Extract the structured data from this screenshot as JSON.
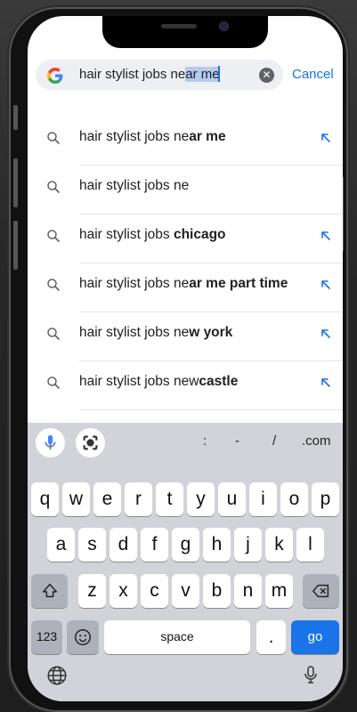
{
  "search": {
    "query_before": "hair stylist jobs ne",
    "query_selected": "ar me",
    "cancel_label": "Cancel",
    "clear_glyph": "✕"
  },
  "suggestions": [
    {
      "prefix": "hair stylist jobs ne",
      "bold": "ar me",
      "suffix": "",
      "has_arrow": true
    },
    {
      "prefix": "hair stylist jobs ne",
      "bold": "",
      "suffix": "",
      "has_arrow": false
    },
    {
      "prefix": "hair stylist jobs ",
      "bold": "chicago",
      "suffix": "",
      "has_arrow": true
    },
    {
      "prefix": "hair stylist jobs ne",
      "bold": "ar me part time",
      "suffix": "",
      "has_arrow": true
    },
    {
      "prefix": "hair stylist jobs ne",
      "bold": "w york",
      "suffix": "",
      "has_arrow": true
    },
    {
      "prefix": "hair stylist jobs new",
      "bold": "castle",
      "suffix": "",
      "has_arrow": true
    }
  ],
  "keyboard": {
    "toolbar_symbols": [
      ":",
      "-",
      "/",
      ".com"
    ],
    "row1": [
      "q",
      "w",
      "e",
      "r",
      "t",
      "y",
      "u",
      "i",
      "o",
      "p"
    ],
    "row2": [
      "a",
      "s",
      "d",
      "f",
      "g",
      "h",
      "j",
      "k",
      "l"
    ],
    "row3": [
      "z",
      "x",
      "c",
      "v",
      "b",
      "n",
      "m"
    ],
    "numbers_label": "123",
    "space_label": "space",
    "period_label": ".",
    "go_label": "go"
  },
  "colors": {
    "accent": "#1a73e8",
    "keyboard_bg": "#d1d3d9",
    "search_bg": "#eeeff3"
  },
  "icons": {
    "logo": "google-g-logo",
    "suggestion": "search-icon",
    "fill_query": "arrow-up-left-icon",
    "mic": "microphone-icon",
    "lens": "lens-scan-icon",
    "shift": "shift-icon",
    "delete": "backspace-icon",
    "emoji": "emoji-icon",
    "globe": "globe-icon",
    "dictation": "dictation-mic-icon"
  }
}
